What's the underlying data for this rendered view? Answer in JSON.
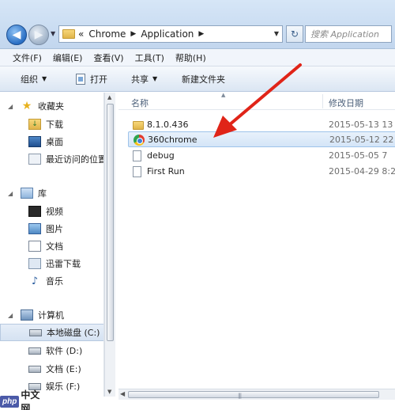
{
  "address_bar": {
    "prefix": "«",
    "crumbs": [
      "Chrome",
      "Application"
    ],
    "search_placeholder": "搜索 Application"
  },
  "menu": [
    "文件(F)",
    "编辑(E)",
    "查看(V)",
    "工具(T)",
    "帮助(H)"
  ],
  "commands": {
    "organize": "组织",
    "open": "打开",
    "share": "共享",
    "new_folder": "新建文件夹"
  },
  "nav": {
    "favorites": {
      "label": "收藏夹",
      "items": [
        "下载",
        "桌面",
        "最近访问的位置"
      ]
    },
    "libraries": {
      "label": "库",
      "items": [
        "视频",
        "图片",
        "文档",
        "迅雷下载",
        "音乐"
      ]
    },
    "computer": {
      "label": "计算机",
      "items": [
        "本地磁盘 (C:)",
        "软件 (D:)",
        "文档 (E:)",
        "娱乐 (F:)"
      ]
    }
  },
  "columns": {
    "name": "名称",
    "date": "修改日期"
  },
  "files": [
    {
      "name": "8.1.0.436",
      "date": "2015-05-13 13",
      "type": "folder"
    },
    {
      "name": "360chrome",
      "date": "2015-05-12 22",
      "type": "app"
    },
    {
      "name": "debug",
      "date": "2015-05-05 7",
      "type": "file"
    },
    {
      "name": "First Run",
      "date": "2015-04-29 8:2",
      "type": "file"
    }
  ],
  "watermarks": {
    "php_badge": "php",
    "php_text": "中文网"
  },
  "colors": {
    "annotation_arrow": "#e02418",
    "selection": "#d4e5f7",
    "titlebar": "#c2d6ee"
  }
}
